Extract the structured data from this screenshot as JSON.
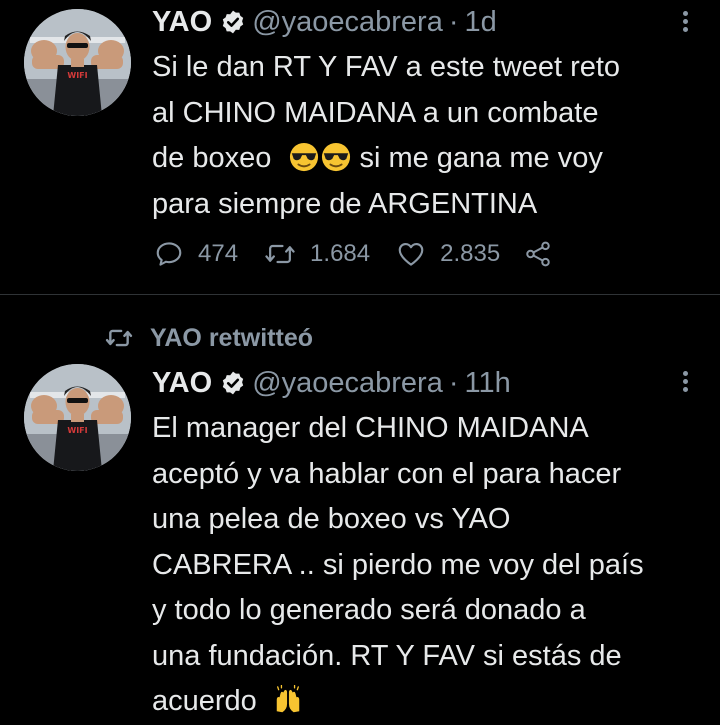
{
  "tweets": [
    {
      "name": "YAO",
      "handle": "@yaoecabrera",
      "separator": "·",
      "time": "1d",
      "avatar_text": "WIFI",
      "lines": [
        "Si le dan RT Y FAV a este tweet reto",
        "al CHINO MAIDANA a un combate",
        "de boxeo",
        " si me gana me voy",
        "para siempre de ARGENTINA"
      ],
      "replies": "474",
      "retweets": "1.684",
      "likes": "2.835"
    },
    {
      "retweet_label": "YAO retwitteó",
      "name": "YAO",
      "handle": "@yaoecabrera",
      "separator": "·",
      "time": "11h",
      "avatar_text": "WIFI",
      "lines": [
        "El manager del CHINO MAIDANA",
        "aceptó y va hablar con el para hacer",
        "una pelea de boxeo vs YAO",
        "CABRERA .. si pierdo me voy del país",
        "y todo lo generado será donado a",
        "una fundación. RT Y FAV si estás de",
        "acuerdo"
      ]
    }
  ],
  "colors": {
    "background": "#000000",
    "text": "#e7e9ea",
    "secondary": "#8b98a5",
    "divider": "#2f3336"
  },
  "icons": [
    "verified-badge-icon",
    "more-options-icon",
    "reply-icon",
    "retweet-icon",
    "like-icon",
    "share-icon",
    "sunglasses-emoji",
    "raised-hands-emoji"
  ]
}
